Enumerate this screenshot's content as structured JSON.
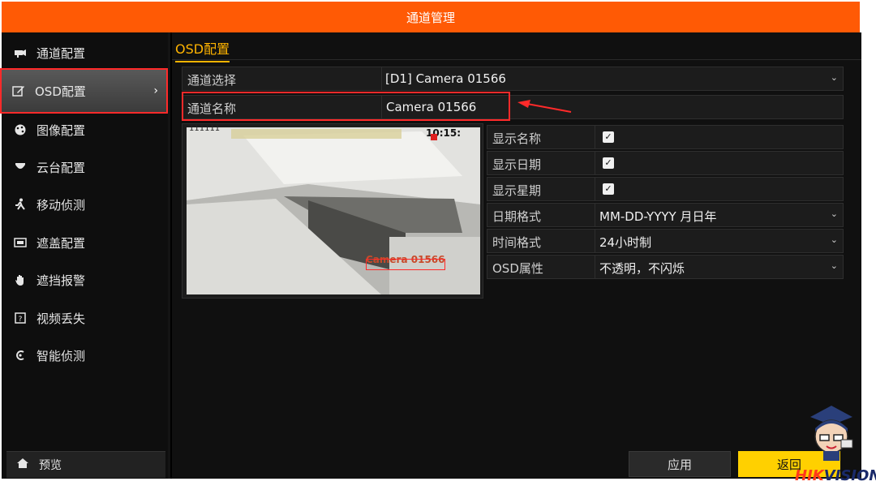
{
  "window": {
    "title": "通道管理"
  },
  "sidebar": {
    "items": [
      {
        "label": "通道配置",
        "icon": "camera-icon"
      },
      {
        "label": "OSD配置",
        "icon": "edit-icon",
        "active": true
      },
      {
        "label": "图像配置",
        "icon": "palette-icon"
      },
      {
        "label": "云台配置",
        "icon": "ptz-icon"
      },
      {
        "label": "移动侦测",
        "icon": "running-man-icon"
      },
      {
        "label": "遮盖配置",
        "icon": "mask-icon"
      },
      {
        "label": "遮挡报警",
        "icon": "hand-icon"
      },
      {
        "label": "视频丢失",
        "icon": "video-loss-icon"
      },
      {
        "label": "智能侦测",
        "icon": "smart-detect-icon"
      }
    ],
    "preview_label": "预览"
  },
  "main": {
    "tab": "OSD配置",
    "channel_select": {
      "label": "通道选择",
      "value": "[D1] Camera 01566"
    },
    "channel_name": {
      "label": "通道名称",
      "value": "Camera 01566"
    },
    "video": {
      "top_left_text": "111111",
      "clock_text": "10:15:",
      "camera_text": "Camera 01566"
    },
    "settings": [
      {
        "label": "显示名称",
        "checked": true
      },
      {
        "label": "显示日期",
        "checked": true
      },
      {
        "label": "显示星期",
        "checked": true
      },
      {
        "label": "日期格式",
        "value": "MM-DD-YYYY 月日年"
      },
      {
        "label": "时间格式",
        "value": "24小时制"
      },
      {
        "label": "OSD属性",
        "value": "不透明，不闪烁"
      }
    ]
  },
  "buttons": {
    "apply": "应用",
    "back": "返回"
  },
  "brand": {
    "part1": "HIK",
    "part2": "VISION"
  },
  "colors": {
    "title_bar": "#ff5a05",
    "accent": "#ffb400",
    "back_button": "#ffd000",
    "highlight": "#ff2a2a"
  }
}
